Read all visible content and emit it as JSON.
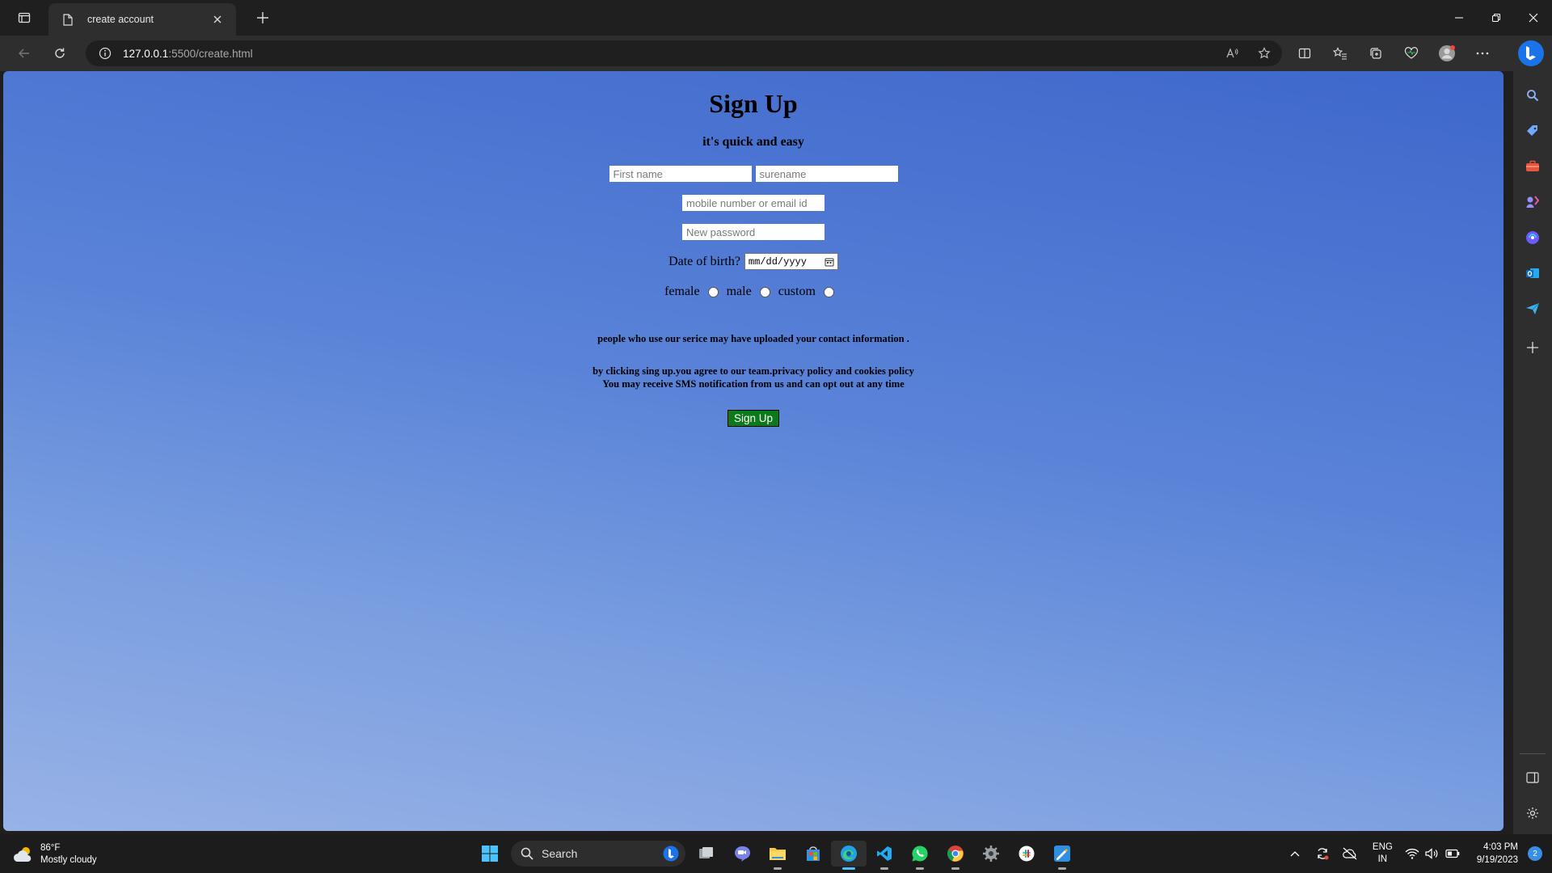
{
  "browser": {
    "tab_title": "create account",
    "address": {
      "host": "127.0.0.1",
      "path": ":5500/create.html"
    }
  },
  "page": {
    "title": "Sign Up",
    "subtitle": "it's quick and easy",
    "first_name_placeholder": "First name",
    "surname_placeholder": "surename",
    "contact_placeholder": "mobile number or email id",
    "password_placeholder": "New password",
    "dob_label": "Date of birth?",
    "dob_placeholder": "mm/dd/yyyy",
    "gender": {
      "female": "female",
      "male": "male",
      "custom": "custom"
    },
    "info_text": "people who use our serice may have uploaded your contact information .",
    "terms_line1": "by clicking sing up.you agree to our team.privacy policy and cookies policy",
    "terms_line2": "You may receive SMS notification from us and can opt out at any time",
    "signup_button": "Sign Up"
  },
  "taskbar": {
    "weather_temp": "86°F",
    "weather_desc": "Mostly cloudy",
    "search_label": "Search",
    "lang_line1": "ENG",
    "lang_line2": "IN",
    "time": "4:03 PM",
    "date": "9/19/2023",
    "notification_count": "2"
  },
  "colors": {
    "page_gradient_top": "#3e67cc",
    "page_gradient_bottom": "#98b2e6",
    "signup_button": "#0a7a1a",
    "edge_accent": "#1a73e8"
  }
}
